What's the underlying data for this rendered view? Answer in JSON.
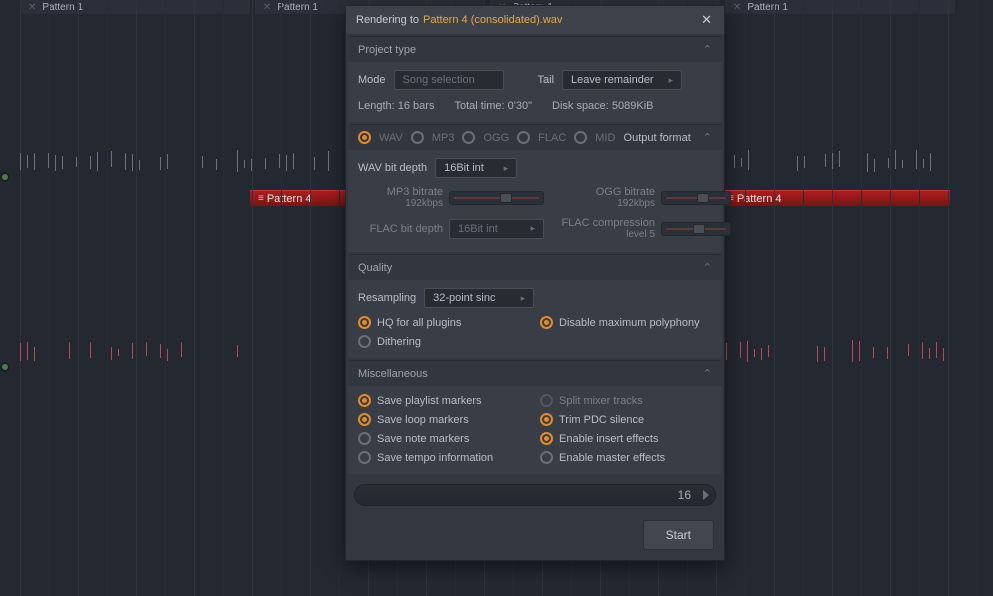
{
  "playlist": {
    "pattern1_label": "Pattern 1",
    "pattern4_label": "Pattern 4"
  },
  "dialog": {
    "title_prefix": "Rendering to ",
    "title_file": "Pattern 4 (consolidated).wav",
    "project_type": {
      "title": "Project type",
      "mode_label": "Mode",
      "mode_value": "Song selection",
      "tail_label": "Tail",
      "tail_value": "Leave remainder",
      "length_label": "Length: 16 bars",
      "total_time_label": "Total time: 0'30\"",
      "disk_space_label": "Disk space: 5089KiB"
    },
    "output_format": {
      "title": "Output format",
      "formats": [
        {
          "label": "WAV",
          "on": true
        },
        {
          "label": "MP3",
          "on": false
        },
        {
          "label": "OGG",
          "on": false
        },
        {
          "label": "FLAC",
          "on": false
        },
        {
          "label": "MID",
          "on": false
        }
      ],
      "wav_depth_label": "WAV bit depth",
      "wav_depth_value": "16Bit int",
      "mp3_label": "MP3 bitrate",
      "mp3_sub": "192kbps",
      "ogg_label": "OGG bitrate",
      "ogg_sub": "192kbps",
      "flac_depth_label": "FLAC bit depth",
      "flac_depth_value": "16Bit int",
      "flac_comp_label": "FLAC compression",
      "flac_comp_sub": "level 5"
    },
    "quality": {
      "title": "Quality",
      "resampling_label": "Resampling",
      "resampling_value": "32-point sinc",
      "hq_label": "HQ for all plugins",
      "disable_poly_label": "Disable maximum polyphony",
      "dithering_label": "Dithering"
    },
    "misc": {
      "title": "Miscellaneous",
      "items": [
        {
          "label": "Save playlist markers",
          "on": true,
          "dim": false
        },
        {
          "label": "Split mixer tracks",
          "on": false,
          "dim": true
        },
        {
          "label": "Save loop markers",
          "on": true,
          "dim": false
        },
        {
          "label": "Trim PDC silence",
          "on": true,
          "dim": false
        },
        {
          "label": "Save note markers",
          "on": false,
          "dim": false
        },
        {
          "label": "Enable insert effects",
          "on": true,
          "dim": false
        },
        {
          "label": "Save tempo information",
          "on": false,
          "dim": false
        },
        {
          "label": "Enable master effects",
          "on": false,
          "dim": false
        }
      ]
    },
    "progress_value": "16",
    "start_label": "Start"
  }
}
